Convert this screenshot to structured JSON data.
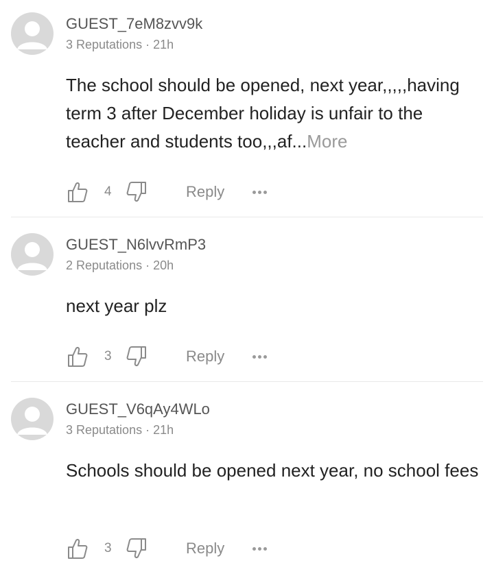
{
  "colors": {
    "text": "#222222",
    "muted": "#8a8a8a",
    "avatar": "#d9d9d9",
    "divider": "#e8e8e8"
  },
  "comments": [
    {
      "user": "GUEST_7eM8zvv9k",
      "meta": "3 Reputations · 21h",
      "body": "The school  should  be  opened, next year,,,,,having  term 3 after December  holiday  is unfair to the teacher  and students too,,,af...",
      "more_label": "More",
      "likes": "4",
      "reply_label": "Reply"
    },
    {
      "user": "GUEST_N6lvvRmP3",
      "meta": "2 Reputations · 20h",
      "body": "next year plz",
      "likes": "3",
      "reply_label": "Reply"
    },
    {
      "user": "GUEST_V6qAy4WLo",
      "meta": "3 Reputations · 21h",
      "body": "Schools should be opened next year, no school fees",
      "likes": "3",
      "reply_label": "Reply"
    }
  ],
  "icons": {
    "like": "thumbs-up-icon",
    "dislike": "thumbs-down-icon",
    "more": "more-options-icon",
    "avatar": "user-avatar-icon"
  }
}
